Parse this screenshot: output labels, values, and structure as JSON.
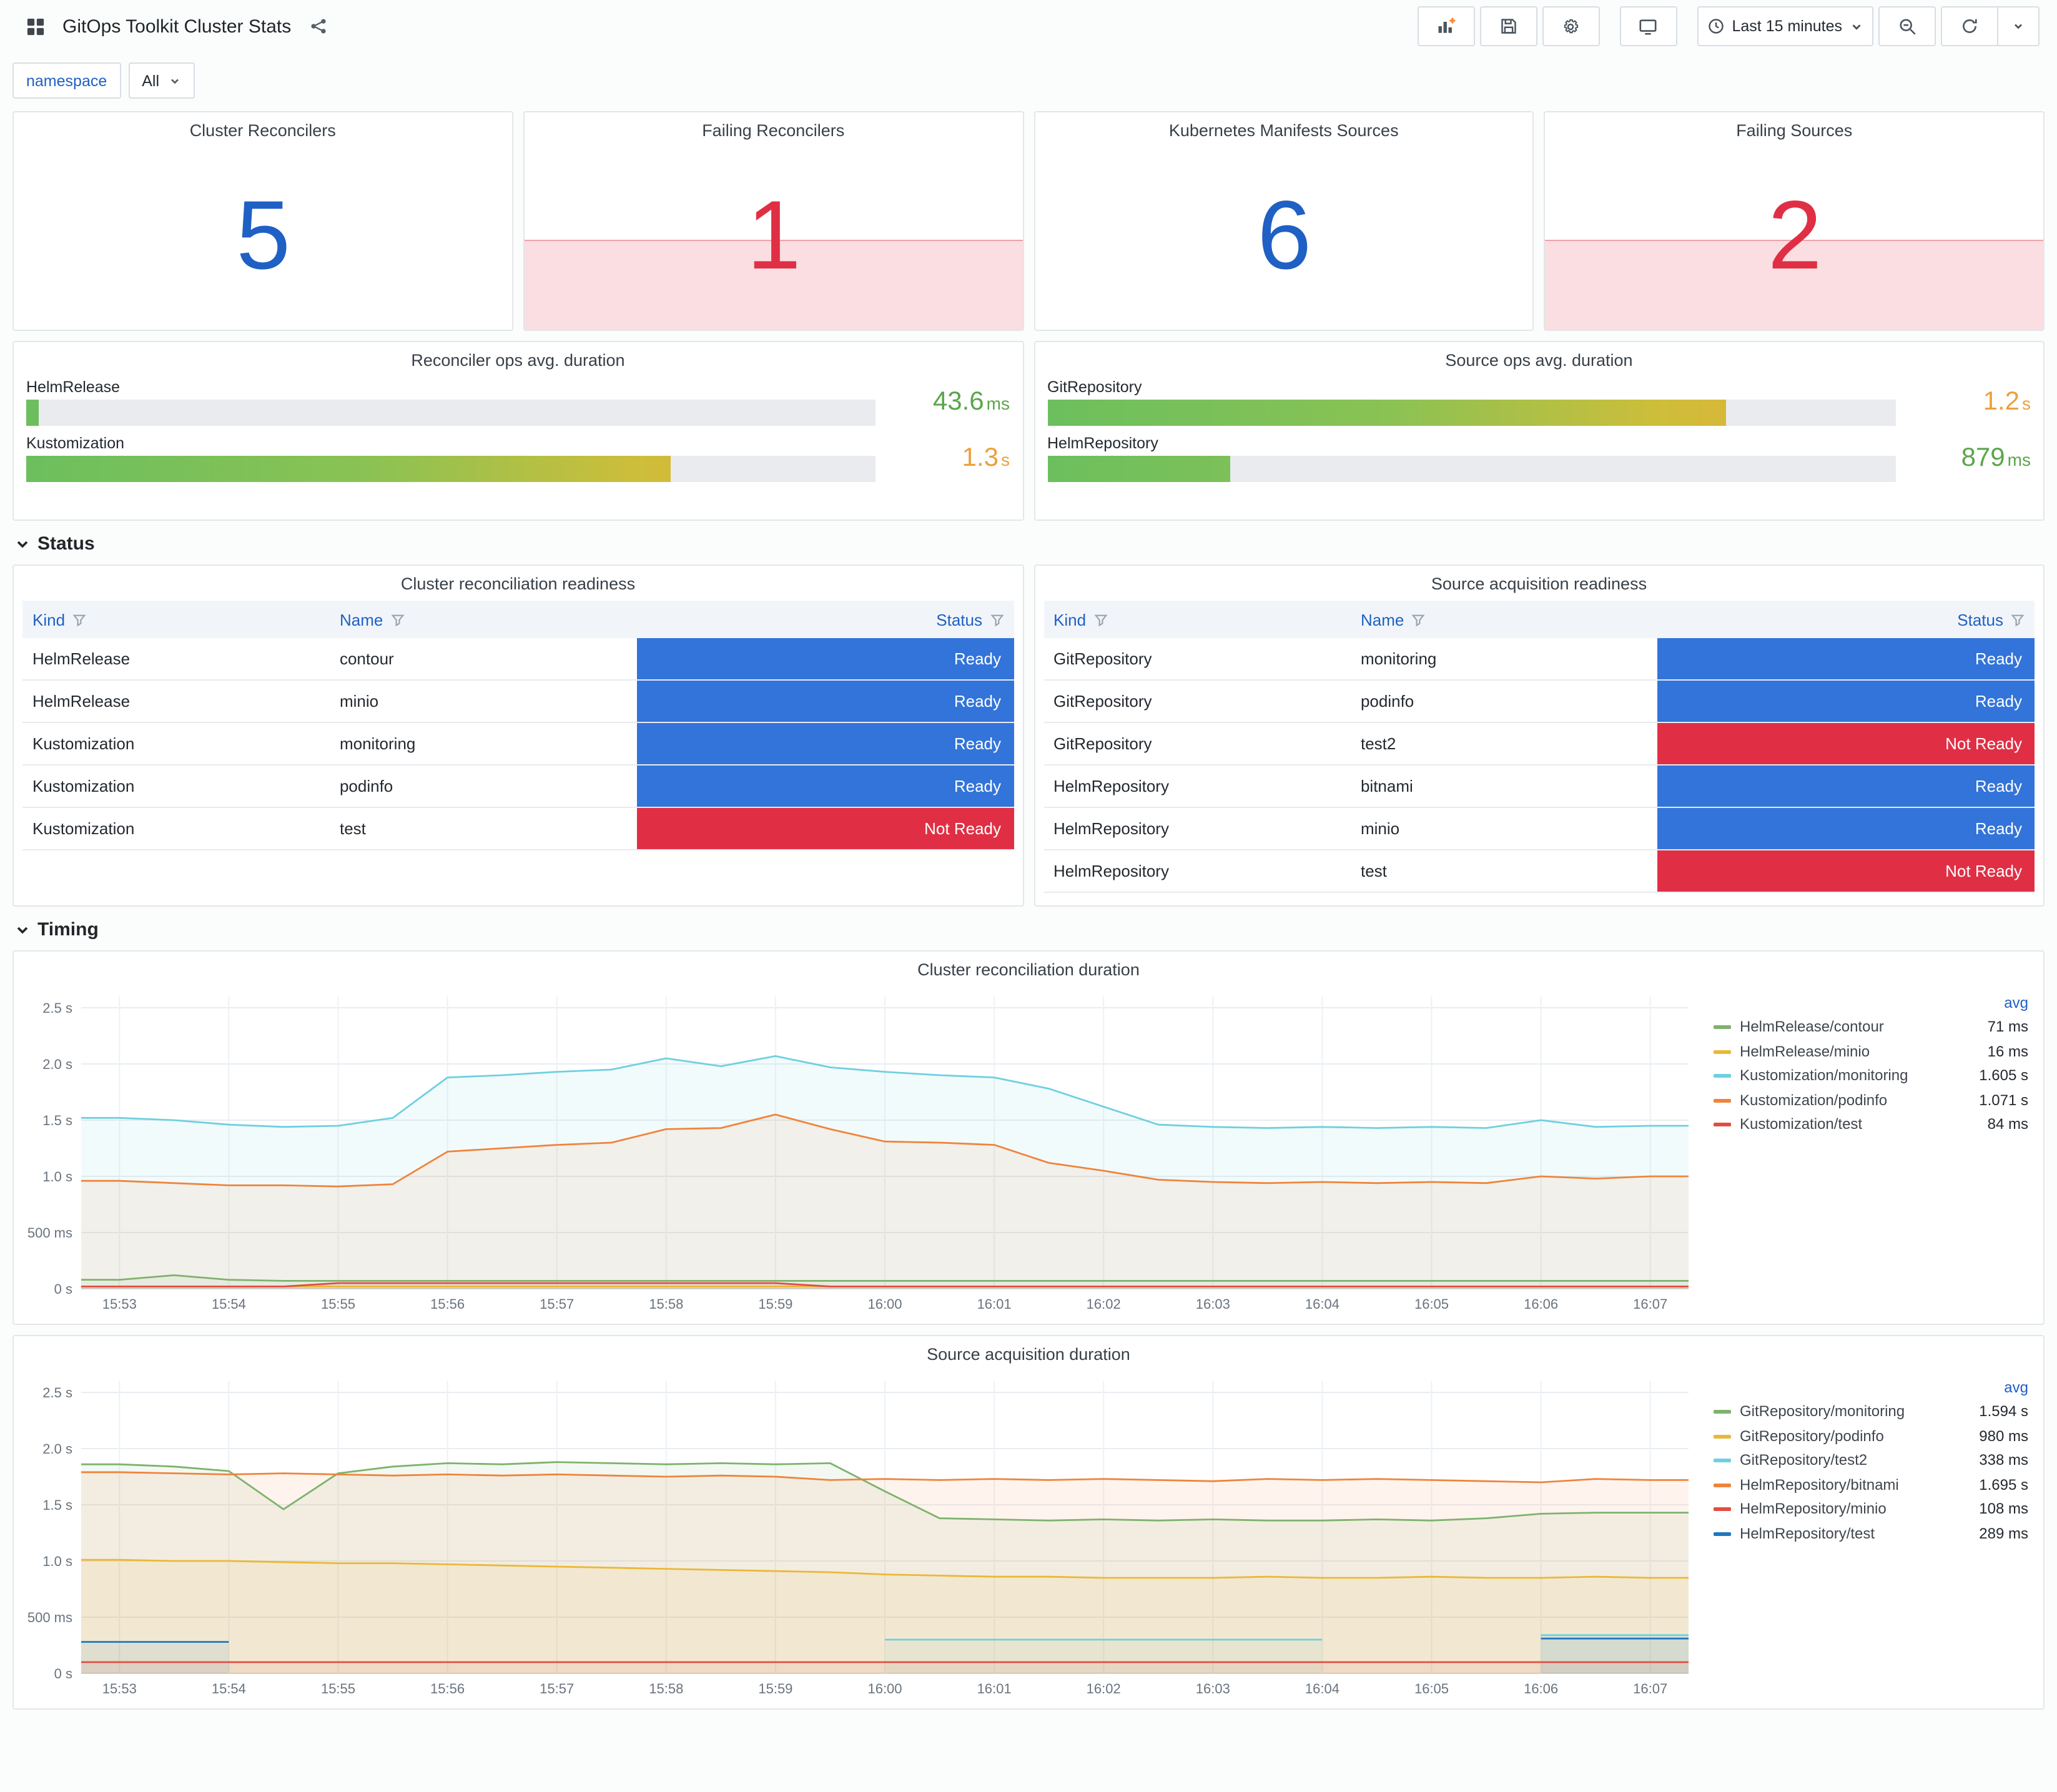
{
  "header": {
    "title": "GitOps Toolkit Cluster Stats",
    "time_range": "Last 15 minutes",
    "toolbar_icons": [
      "add-panel",
      "save-dashboard",
      "dashboard-settings",
      "cycle-view-mode",
      "time-range-picker",
      "zoom-out",
      "refresh",
      "refresh-interval-dropdown"
    ]
  },
  "filters": {
    "name_label": "namespace",
    "value": "All"
  },
  "stats": [
    {
      "title": "Cluster Reconcilers",
      "value": "5",
      "color": "#1F60C4"
    },
    {
      "title": "Failing Reconcilers",
      "value": "1",
      "color": "#E02F44",
      "area_color": "rgba(224,47,68,0.16)"
    },
    {
      "title": "Kubernetes Manifests Sources",
      "value": "6",
      "color": "#1F60C4"
    },
    {
      "title": "Failing Sources",
      "value": "2",
      "color": "#E02F44",
      "area_color": "rgba(224,47,68,0.16)"
    }
  ],
  "gauges": [
    {
      "title": "Reconciler ops avg. duration",
      "rows": [
        {
          "label": "HelmRelease",
          "value": "43.6",
          "unit": "ms",
          "percent": 1.5,
          "value_color": "#5AA64B"
        },
        {
          "label": "Kustomization",
          "value": "1.3",
          "unit": "s",
          "percent": 76,
          "value_color": "#EBA13C"
        }
      ]
    },
    {
      "title": "Source ops avg. duration",
      "rows": [
        {
          "label": "GitRepository",
          "value": "1.2",
          "unit": "s",
          "percent": 80,
          "value_color": "#EBA13C"
        },
        {
          "label": "HelmRepository",
          "value": "879",
          "unit": "ms",
          "percent": 21.5,
          "value_color": "#5AA64B"
        }
      ]
    }
  ],
  "sections": {
    "status": "Status",
    "timing": "Timing"
  },
  "tables": [
    {
      "title": "Cluster reconciliation readiness",
      "columns": [
        "Kind",
        "Name",
        "Status"
      ],
      "rows": [
        {
          "kind": "HelmRelease",
          "name": "contour",
          "status": "Ready",
          "ok": true
        },
        {
          "kind": "HelmRelease",
          "name": "minio",
          "status": "Ready",
          "ok": true
        },
        {
          "kind": "Kustomization",
          "name": "monitoring",
          "status": "Ready",
          "ok": true
        },
        {
          "kind": "Kustomization",
          "name": "podinfo",
          "status": "Ready",
          "ok": true
        },
        {
          "kind": "Kustomization",
          "name": "test",
          "status": "Not Ready",
          "ok": false
        }
      ]
    },
    {
      "title": "Source acquisition readiness",
      "columns": [
        "Kind",
        "Name",
        "Status"
      ],
      "rows": [
        {
          "kind": "GitRepository",
          "name": "monitoring",
          "status": "Ready",
          "ok": true
        },
        {
          "kind": "GitRepository",
          "name": "podinfo",
          "status": "Ready",
          "ok": true
        },
        {
          "kind": "GitRepository",
          "name": "test2",
          "status": "Not Ready",
          "ok": false
        },
        {
          "kind": "HelmRepository",
          "name": "bitnami",
          "status": "Ready",
          "ok": true
        },
        {
          "kind": "HelmRepository",
          "name": "minio",
          "status": "Ready",
          "ok": true
        },
        {
          "kind": "HelmRepository",
          "name": "test",
          "status": "Not Ready",
          "ok": false
        }
      ]
    }
  ],
  "chart_data": [
    {
      "type": "line",
      "title": "Cluster reconciliation duration",
      "legend_header": "avg",
      "ylim": [
        0,
        2.6
      ],
      "y_ticks": [
        {
          "v": 0,
          "label": "0 s"
        },
        {
          "v": 0.5,
          "label": "500 ms"
        },
        {
          "v": 1.0,
          "label": "1.0 s"
        },
        {
          "v": 1.5,
          "label": "1.5 s"
        },
        {
          "v": 2.0,
          "label": "2.0 s"
        },
        {
          "v": 2.5,
          "label": "2.5 s"
        }
      ],
      "x_ticks": [
        "15:53",
        "15:54",
        "15:55",
        "15:56",
        "15:57",
        "15:58",
        "15:59",
        "16:00",
        "16:01",
        "16:02",
        "16:03",
        "16:04",
        "16:05",
        "16:06",
        "16:07"
      ],
      "series": [
        {
          "name": "HelmRelease/contour",
          "avg": "71 ms",
          "color": "#7EB26D",
          "values": [
            0.08,
            0.12,
            0.08,
            0.07,
            0.07,
            0.07,
            0.07,
            0.07,
            0.07,
            0.07,
            0.07,
            0.07,
            0.07,
            0.07,
            0.07,
            0.07,
            0.07,
            0.07,
            0.07,
            0.07,
            0.07,
            0.07,
            0.07,
            0.07,
            0.07,
            0.07,
            0.07,
            0.07,
            0.07
          ]
        },
        {
          "name": "HelmRelease/minio",
          "avg": "16 ms",
          "color": "#EAB839",
          "values": [
            0.02,
            0.02,
            0.02,
            0.02,
            0.02,
            0.02,
            0.02,
            0.02,
            0.02,
            0.02,
            0.02,
            0.02,
            0.02,
            0.02,
            0.02,
            0.02,
            0.02,
            0.02,
            0.02,
            0.02,
            0.02,
            0.02,
            0.02,
            0.02,
            0.02,
            0.02,
            0.02,
            0.02,
            0.02
          ]
        },
        {
          "name": "Kustomization/monitoring",
          "avg": "1.605 s",
          "color": "#6ED0E0",
          "values": [
            1.52,
            1.5,
            1.46,
            1.44,
            1.45,
            1.52,
            1.88,
            1.9,
            1.93,
            1.95,
            2.05,
            1.98,
            2.07,
            1.97,
            1.93,
            1.9,
            1.88,
            1.78,
            1.62,
            1.46,
            1.44,
            1.43,
            1.44,
            1.43,
            1.44,
            1.43,
            1.5,
            1.44,
            1.45
          ]
        },
        {
          "name": "Kustomization/podinfo",
          "avg": "1.071 s",
          "color": "#EF843C",
          "values": [
            0.96,
            0.94,
            0.92,
            0.92,
            0.91,
            0.93,
            1.22,
            1.25,
            1.28,
            1.3,
            1.42,
            1.43,
            1.55,
            1.42,
            1.31,
            1.3,
            1.28,
            1.12,
            1.05,
            0.97,
            0.95,
            0.94,
            0.95,
            0.94,
            0.95,
            0.94,
            1.0,
            0.98,
            1.0
          ]
        },
        {
          "name": "Kustomization/test",
          "avg": "84 ms",
          "color": "#E24D42",
          "values": [
            0.02,
            0.02,
            0.02,
            0.02,
            0.05,
            0.05,
            0.05,
            0.05,
            0.05,
            0.05,
            0.05,
            0.05,
            0.05,
            0.02,
            0.02,
            0.02,
            0.02,
            0.02,
            0.02,
            0.02,
            0.02,
            0.02,
            0.02,
            0.02,
            0.02,
            0.02,
            0.02,
            0.02,
            0.02
          ]
        }
      ]
    },
    {
      "type": "line",
      "title": "Source acquisition duration",
      "legend_header": "avg",
      "ylim": [
        0,
        2.6
      ],
      "y_ticks": [
        {
          "v": 0,
          "label": "0 s"
        },
        {
          "v": 0.5,
          "label": "500 ms"
        },
        {
          "v": 1.0,
          "label": "1.0 s"
        },
        {
          "v": 1.5,
          "label": "1.5 s"
        },
        {
          "v": 2.0,
          "label": "2.0 s"
        },
        {
          "v": 2.5,
          "label": "2.5 s"
        }
      ],
      "x_ticks": [
        "15:53",
        "15:54",
        "15:55",
        "15:56",
        "15:57",
        "15:58",
        "15:59",
        "16:00",
        "16:01",
        "16:02",
        "16:03",
        "16:04",
        "16:05",
        "16:06",
        "16:07"
      ],
      "series": [
        {
          "name": "GitRepository/monitoring",
          "avg": "1.594 s",
          "color": "#7EB26D",
          "values": [
            1.86,
            1.84,
            1.8,
            1.46,
            1.78,
            1.84,
            1.87,
            1.86,
            1.88,
            1.87,
            1.86,
            1.87,
            1.86,
            1.87,
            1.62,
            1.38,
            1.37,
            1.36,
            1.37,
            1.36,
            1.37,
            1.36,
            1.36,
            1.37,
            1.36,
            1.38,
            1.42,
            1.43,
            1.43
          ]
        },
        {
          "name": "GitRepository/podinfo",
          "avg": "980 ms",
          "color": "#EAB839",
          "values": [
            1.01,
            1.0,
            1.0,
            0.99,
            0.98,
            0.98,
            0.97,
            0.96,
            0.95,
            0.94,
            0.93,
            0.92,
            0.91,
            0.9,
            0.88,
            0.87,
            0.86,
            0.86,
            0.85,
            0.85,
            0.85,
            0.86,
            0.85,
            0.85,
            0.86,
            0.85,
            0.85,
            0.86,
            0.85
          ]
        },
        {
          "name": "GitRepository/test2",
          "avg": "338 ms",
          "color": "#6ED0E0",
          "values": [
            null,
            null,
            null,
            null,
            null,
            null,
            null,
            null,
            null,
            null,
            null,
            null,
            null,
            null,
            0.3,
            0.3,
            0.3,
            0.3,
            0.3,
            0.3,
            0.3,
            0.3,
            0.3,
            null,
            null,
            null,
            0.34,
            0.34,
            0.34
          ]
        },
        {
          "name": "HelmRepository/bitnami",
          "avg": "1.695 s",
          "color": "#EF843C",
          "values": [
            1.79,
            1.78,
            1.77,
            1.78,
            1.77,
            1.76,
            1.77,
            1.76,
            1.77,
            1.76,
            1.75,
            1.76,
            1.75,
            1.72,
            1.73,
            1.72,
            1.73,
            1.72,
            1.73,
            1.72,
            1.71,
            1.73,
            1.72,
            1.73,
            1.72,
            1.71,
            1.7,
            1.73,
            1.72
          ]
        },
        {
          "name": "HelmRepository/minio",
          "avg": "108 ms",
          "color": "#E24D42",
          "values": [
            0.1,
            0.1,
            0.1,
            0.1,
            0.1,
            0.1,
            0.1,
            0.1,
            0.1,
            0.1,
            0.1,
            0.1,
            0.1,
            0.1,
            0.1,
            0.1,
            0.1,
            0.1,
            0.1,
            0.1,
            0.1,
            0.1,
            0.1,
            0.1,
            0.1,
            0.1,
            0.1,
            0.1,
            0.1
          ]
        },
        {
          "name": "HelmRepository/test",
          "avg": "289 ms",
          "color": "#1F78C1",
          "values": [
            0.28,
            0.28,
            0.28,
            null,
            null,
            null,
            null,
            null,
            null,
            null,
            null,
            null,
            null,
            null,
            null,
            null,
            null,
            null,
            null,
            null,
            null,
            null,
            null,
            null,
            null,
            null,
            0.31,
            0.31,
            0.31
          ]
        }
      ]
    }
  ]
}
